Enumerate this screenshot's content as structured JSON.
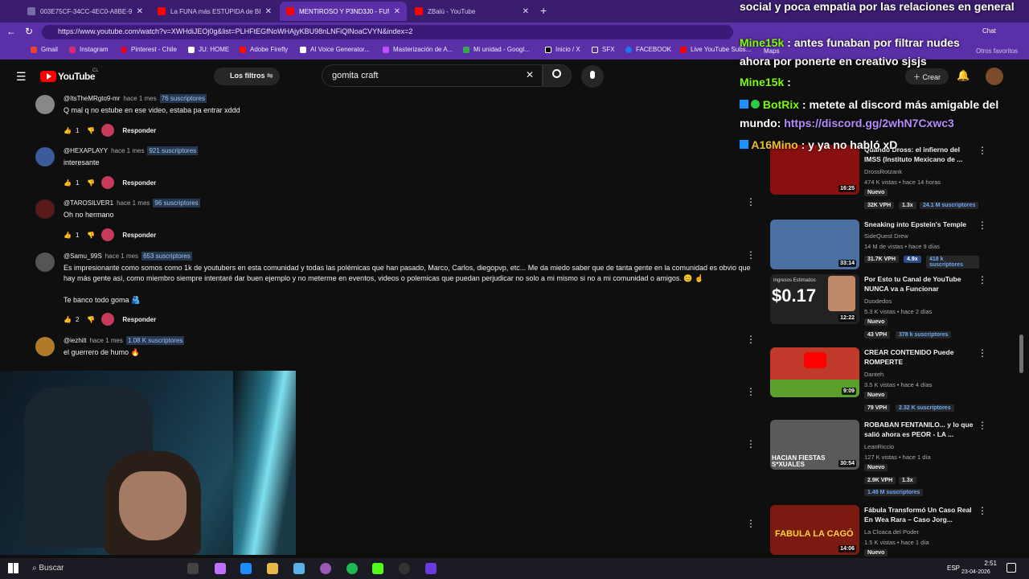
{
  "browser": {
    "tabs": [
      {
        "title": "003E75CF-34CC-4EC0-A8BE-9D03...",
        "active": false,
        "color": "#7a6aa8"
      },
      {
        "title": "La FUNA más ESTÚPIDA de BEDR...",
        "active": false,
        "color": "#ff0000"
      },
      {
        "title": "MENTIROSO Y P3ND3J0 - FUNA A...",
        "active": true,
        "color": "#ff0000"
      },
      {
        "title": "ZBalú - YouTube",
        "active": false,
        "color": "#ff0000"
      }
    ],
    "url": "https://www.youtube.com/watch?v=XWHdiJEOj0g&list=PLHFtEGfNoWHAjyKBU98nLNFiQlNoaCVYN&index=2",
    "bookmarks": [
      "Gmail",
      "Instagram",
      "Pinterest - Chile",
      "JU: HOME",
      "Adobe Firefly",
      "AI Voice Generator...",
      "Masterización de A...",
      "Mi unidad - Googl...",
      "Inicio / X",
      "SFX",
      "FACEBOOK",
      "Live YouTube Subs...",
      "Maps"
    ],
    "bookmark_other": "Otros favoritos",
    "chat_label": "Chat"
  },
  "youtube": {
    "logo": "YouTube",
    "country": "CL",
    "filters_label": "Los filtros",
    "search_value": "gomita craft",
    "create_label": "Crear",
    "accent": "#ff0000"
  },
  "comments": [
    {
      "handle": "@ItsTheMRgto9-mr",
      "time": "hace 1 mes",
      "subs": "76 suscriptores",
      "text": "Q mal q no estube en ese video, estaba pa entrar xddd",
      "likes": "1",
      "reply": "Responder"
    },
    {
      "handle": "@HEXAPLAYY",
      "time": "hace 1 mes",
      "subs": "921 suscriptores",
      "text": "interesante",
      "likes": "1",
      "reply": "Responder"
    },
    {
      "handle": "@TAROSILVER1",
      "time": "hace 1 mes",
      "subs": "96 suscriptores",
      "text": "Oh no hermano",
      "likes": "1",
      "reply": "Responder"
    },
    {
      "handle": "@Samu_99S",
      "time": "hace 1 mes",
      "subs": "653 suscriptores",
      "text": "Es impresionante como somos como 1k de youtubers en esta comunidad y todas las polémicas que han pasado, Marco, Carlos, diegopvp, etc... Me da miedo saber que de tanta gente en la comunidad es obvio que hay más gente así, como miembro siempre intentaré dar buen ejemplo y no meterme en eventos, videos o polemicas que puedan perjudicar no solo a mi mismo si no a mi comunidad o amigos. 😊 ☝",
      "text2": "Te banco todo goma 🫂",
      "likes": "2",
      "reply": "Responder"
    },
    {
      "handle": "@iezhilt",
      "time": "hace 1 mes",
      "subs": "1.08 K suscriptores",
      "text": "el guerrero de humo 🔥",
      "likes": "1",
      "reply": "Responder"
    }
  ],
  "videos": [
    {
      "title": "Quando Dross: el infierno del IMSS (Instituto Mexicano de ...",
      "channel": "DrossRotzank",
      "stats": "474 K vistas • hace 14 horas",
      "badge": "Nuevo",
      "chips": [
        "32K VPH",
        "1.3x",
        "24.1 M suscriptores"
      ],
      "duration": "16:25",
      "thumb": "#8a1010"
    },
    {
      "title": "Sneaking into Epstein's Temple",
      "channel": "SideQuest Drew",
      "stats": "14 M de vistas • hace 9 días",
      "badge": "",
      "chips": [
        "31.7K VPH",
        "4.9x",
        "418 k suscriptores"
      ],
      "duration": "33:14",
      "thumb": "#4a6fa0"
    },
    {
      "title": "Por Esto tu Canal de YouTube NUNCA va a Funcionar",
      "channel": "Duodedos",
      "stats": "5.3 K vistas • hace 2 días",
      "badge": "Nuevo",
      "chips": [
        "43 VPH",
        "378 k suscriptores"
      ],
      "duration": "12:22",
      "thumb": "#222222",
      "thumb_text": "$0.17",
      "thumb_small": "Ingresos Estimados"
    },
    {
      "title": "CREAR CONTENIDO Puede ROMPERTE",
      "channel": "Danteh",
      "stats": "3.5 K vistas • hace 4 días",
      "badge": "Nuevo",
      "chips": [
        "79 VPH",
        "2.32 K suscriptores"
      ],
      "duration": "9:09",
      "thumb": "#c0392b"
    },
    {
      "title": "ROBABAN FENTANILO... y lo que salió ahora es PEOR - LA ...",
      "channel": "LeanRiccio",
      "stats": "127 K vistas • hace 1 día",
      "badge": "Nuevo",
      "chips": [
        "2.9K VPH",
        "1.3x",
        "1.49 M suscriptores"
      ],
      "duration": "30:54",
      "thumb": "#5a5a5a",
      "thumb_text": "HACIAN FIESTAS S*XUALES"
    },
    {
      "title": "Fábula Transformó Un Caso Real En Wea Rara – Caso Jorg...",
      "channel": "La Cloaca del Poder",
      "stats": "1.5 K vistas • hace 1 día",
      "badge": "Nuevo",
      "chips": [],
      "duration": "14:06",
      "thumb": "#7a1a10",
      "thumb_text": "FABULA LA CAGÓ"
    }
  ],
  "stream_chat": [
    {
      "user": "",
      "msg": "social y poca empatia por las relaciones en general",
      "color": "#ffffff"
    },
    {
      "user": "Mine15k",
      "msg": ": antes funaban por filtrar nudes",
      "color": "#7CFC00"
    },
    {
      "user": "",
      "msg": "ahora por ponerte en creativo sjsjs",
      "color": "#ffffff"
    },
    {
      "user": "Mine15k",
      "msg": ":",
      "color": "#7CFC00"
    },
    {
      "user": "BotRix",
      "msg": ": metete al discord más amigable del",
      "color": "#7CFC00"
    },
    {
      "user": "",
      "msg": "mundo: ",
      "link": "https://discord.gg/2whN7Cxwc3",
      "color": "#ffffff"
    },
    {
      "user": "A16Mino",
      "msg": ": y ya no habló xD",
      "color": "#e6c22a"
    }
  ],
  "taskbar": {
    "search": "Buscar",
    "lang": "ESP",
    "time": "2:51",
    "date": "23-04-2026"
  }
}
